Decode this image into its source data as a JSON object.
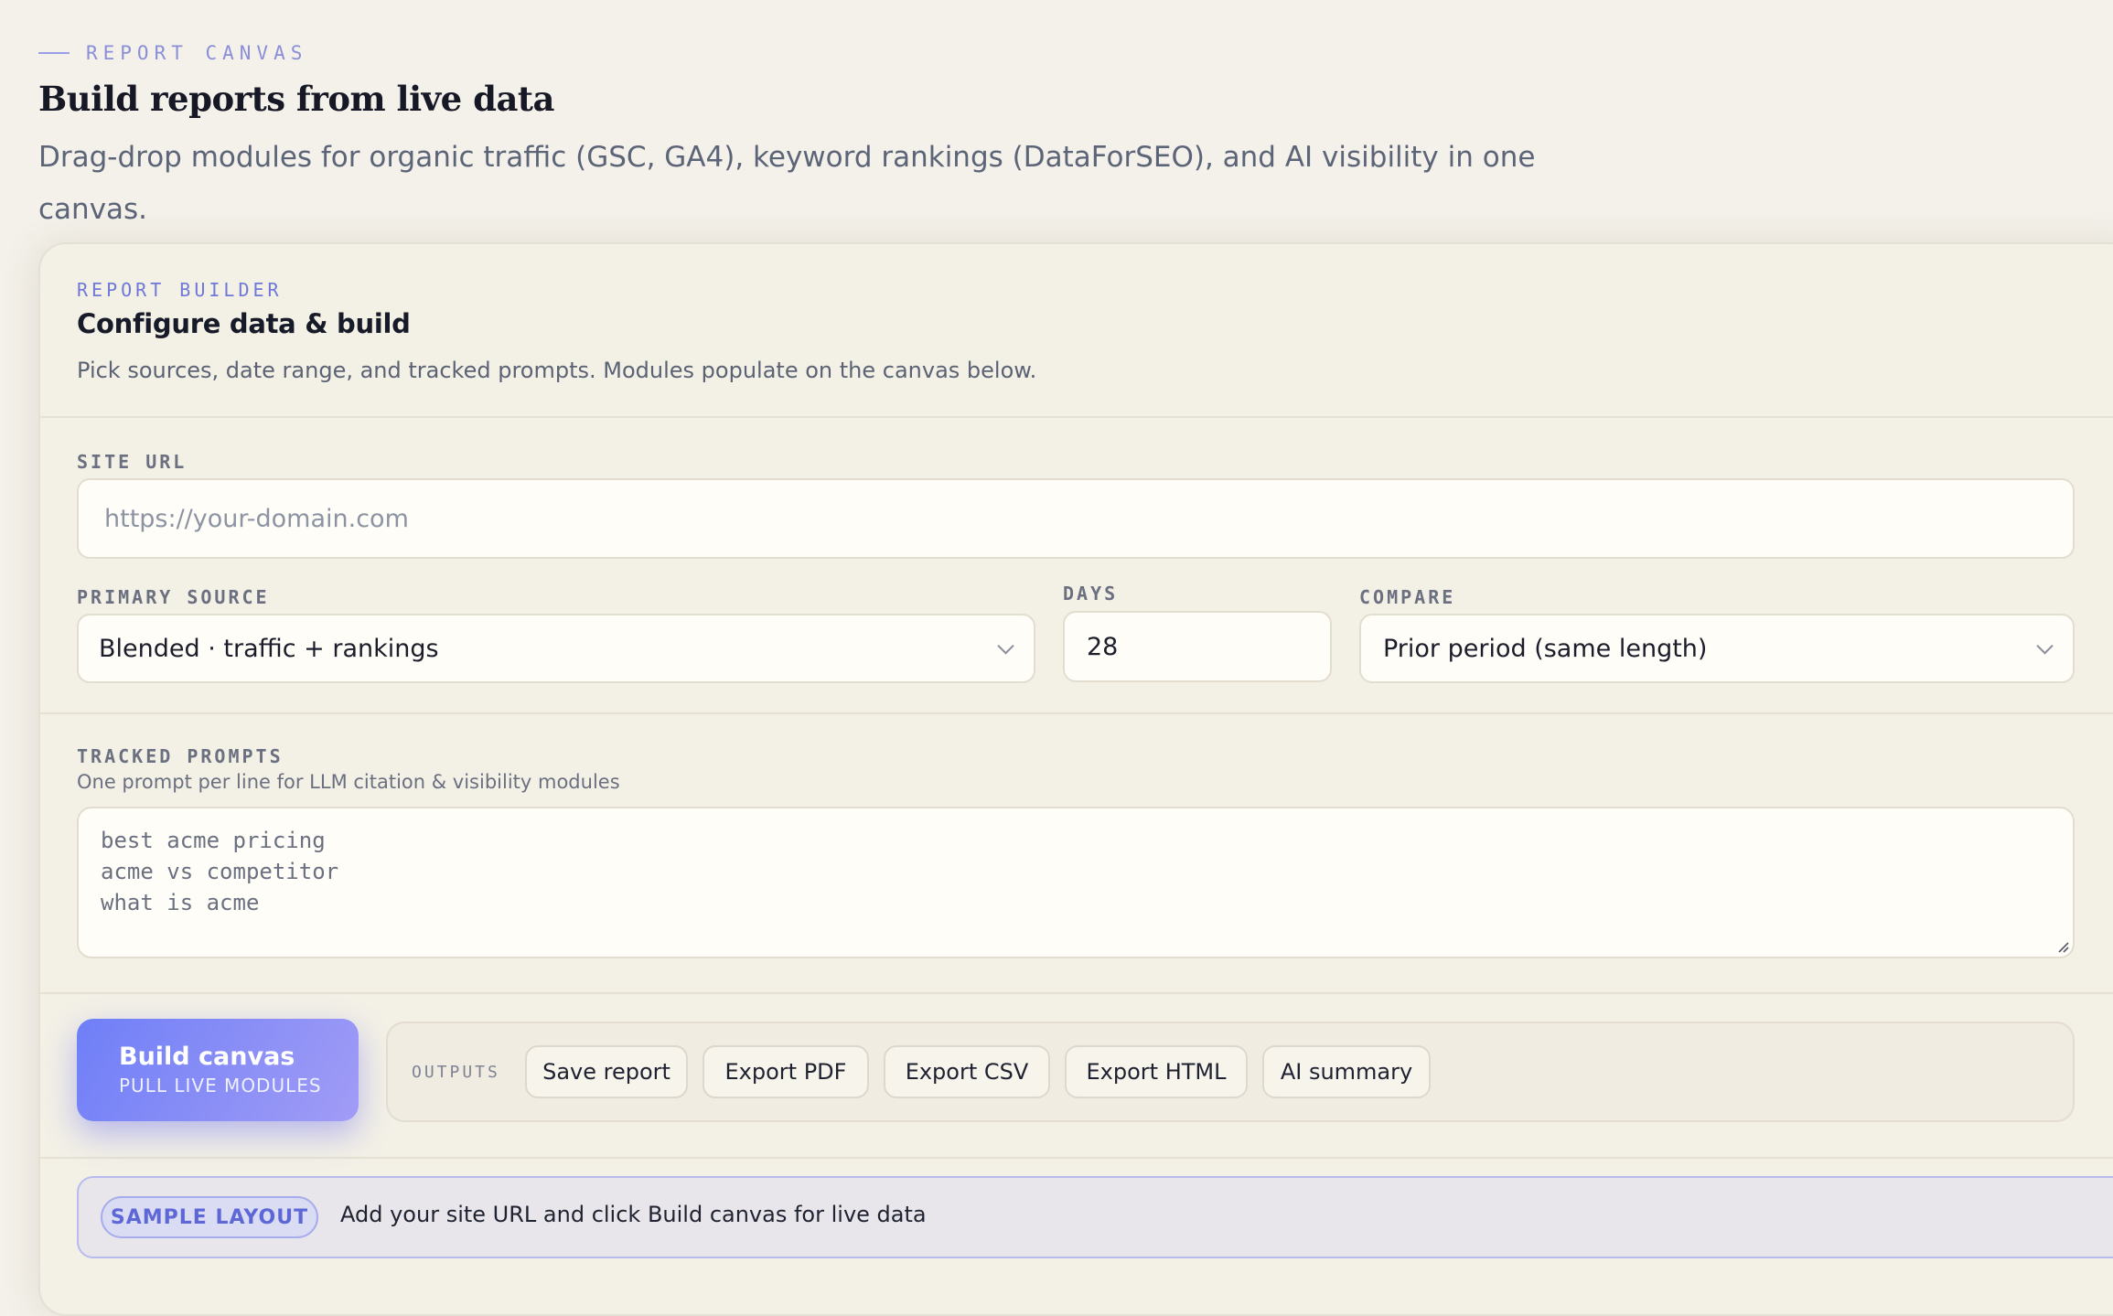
{
  "header": {
    "eyebrow": "REPORT CANVAS",
    "title": "Build reports from live data",
    "description": "Drag-drop modules for organic traffic (GSC, GA4), keyword rankings (DataForSEO), and AI visibility in one canvas."
  },
  "builder": {
    "eyebrow": "REPORT BUILDER",
    "title": "Configure data & build",
    "description": "Pick sources, date range, and tracked prompts. Modules populate on the canvas below."
  },
  "fields": {
    "site_url": {
      "label": "SITE URL",
      "placeholder": "https://your-domain.com"
    },
    "primary_source": {
      "label": "PRIMARY SOURCE",
      "value": "Blended · traffic + rankings"
    },
    "days": {
      "label": "DAYS",
      "value": "28"
    },
    "compare": {
      "label": "COMPARE",
      "value": "Prior period (same length)"
    }
  },
  "prompts": {
    "label": "TRACKED PROMPTS",
    "hint": "One prompt per line for LLM citation & visibility modules",
    "lines": [
      "best acme pricing",
      "acme vs competitor",
      "what is acme"
    ]
  },
  "actions": {
    "build_label": "Build canvas",
    "build_sublabel": "PULL LIVE MODULES",
    "outputs_label": "OUTPUTS",
    "outputs": [
      "Save report",
      "Export PDF",
      "Export CSV",
      "Export HTML",
      "AI summary"
    ]
  },
  "sample": {
    "badge": "SAMPLE LAYOUT",
    "text": "Add your site URL and click Build canvas for live data"
  },
  "colors": {
    "accent": "#6f7ff7",
    "background": "#f4f1ea"
  }
}
